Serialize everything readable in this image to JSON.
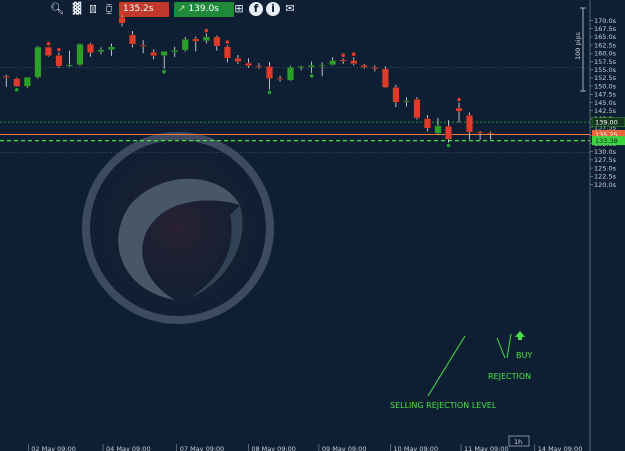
{
  "toolbar": {
    "sell_price": "135.2s",
    "buy_price": "139.0s",
    "icons": [
      "search-icon",
      "bar-chart-icon",
      "chart-type-icon",
      "candle-icon",
      "grid-icon",
      "facebook-icon",
      "info-icon",
      "share-icon"
    ]
  },
  "colors": {
    "background": "#0f1f33",
    "bull": "#2aa02a",
    "bear": "#e03a2a",
    "neutral": "#f0ead0",
    "green_line": "#2aa02a",
    "orange_line": "#f07a3a",
    "annotation": "#46e046"
  },
  "price_axis": {
    "ticks": [
      "170.0s",
      "167.5s",
      "165.0s",
      "162.5s",
      "160.0s",
      "157.5s",
      "155.0s",
      "152.5s",
      "150.0s",
      "147.5s",
      "145.0s",
      "142.5s",
      "140.0s",
      "137.5s",
      "135.0s",
      "132.5s",
      "130.0s",
      "127.5s",
      "125.0s",
      "122.5s",
      "120.0s"
    ],
    "range_label": "100 pips",
    "label_buy": "139.00",
    "label_sell": "135.25",
    "label_level": "133.38"
  },
  "time_axis": {
    "ticks": [
      "02 May 09:00",
      "04 May 09:00",
      "07 May 09:00",
      "08 May 09:00",
      "09 May 09:00",
      "10 May 09:00",
      "11 May 09:00",
      "14 May 09:00"
    ],
    "timeframe": "1h"
  },
  "annotations": {
    "buy": "BUY",
    "rejection": "REJECTION",
    "selling_level": "SELLING REJECTION LEVEL"
  },
  "chart_data": {
    "type": "candlestick",
    "ylim": [
      119.5,
      172
    ],
    "levels": {
      "buy": 139.0,
      "sell": 135.25,
      "rejection_level": 133.38,
      "support_grey": 155.7,
      "lower_grey": 129.8
    },
    "candles": [
      {
        "o": 153.0,
        "h": 153.5,
        "l": 149.8,
        "c": 152.6
      },
      {
        "o": 152.3,
        "h": 152.6,
        "l": 149.8,
        "c": 149.9
      },
      {
        "o": 149.9,
        "h": 152.8,
        "l": 149.5,
        "c": 152.7
      },
      {
        "o": 152.7,
        "h": 162.2,
        "l": 152.3,
        "c": 161.9
      },
      {
        "o": 161.9,
        "h": 162.0,
        "l": 159.0,
        "c": 159.3
      },
      {
        "o": 159.4,
        "h": 160.2,
        "l": 155.6,
        "c": 156.1
      },
      {
        "o": 156.1,
        "h": 160.8,
        "l": 155.8,
        "c": 156.5
      },
      {
        "o": 156.5,
        "h": 163.0,
        "l": 156.2,
        "c": 162.8
      },
      {
        "o": 162.8,
        "h": 163.2,
        "l": 159.0,
        "c": 160.2
      },
      {
        "o": 160.5,
        "h": 161.8,
        "l": 159.7,
        "c": 161.1
      },
      {
        "o": 161.1,
        "h": 163.0,
        "l": 159.2,
        "c": 162.0
      },
      {
        "o": 171.0,
        "h": 171.5,
        "l": 168.2,
        "c": 169.2
      },
      {
        "o": 165.6,
        "h": 166.8,
        "l": 161.8,
        "c": 162.8
      },
      {
        "o": 162.5,
        "h": 164.0,
        "l": 160.0,
        "c": 162.2
      },
      {
        "o": 160.3,
        "h": 161.2,
        "l": 158.2,
        "c": 159.3
      },
      {
        "o": 159.3,
        "h": 160.6,
        "l": 155.3,
        "c": 160.6
      },
      {
        "o": 160.4,
        "h": 162.0,
        "l": 158.9,
        "c": 160.9
      },
      {
        "o": 161.0,
        "h": 165.0,
        "l": 160.5,
        "c": 164.3
      },
      {
        "o": 164.4,
        "h": 165.1,
        "l": 160.6,
        "c": 163.7
      },
      {
        "o": 163.8,
        "h": 166.0,
        "l": 163.0,
        "c": 165.0
      },
      {
        "o": 165.0,
        "h": 165.5,
        "l": 160.8,
        "c": 162.2
      },
      {
        "o": 162.0,
        "h": 162.5,
        "l": 157.2,
        "c": 158.5
      },
      {
        "o": 158.5,
        "h": 159.5,
        "l": 156.8,
        "c": 157.5
      },
      {
        "o": 157.0,
        "h": 158.5,
        "l": 155.6,
        "c": 156.2
      },
      {
        "o": 156.1,
        "h": 157.0,
        "l": 155.3,
        "c": 155.8
      },
      {
        "o": 156.0,
        "h": 157.4,
        "l": 149.0,
        "c": 152.3
      },
      {
        "o": 152.4,
        "h": 153.2,
        "l": 151.4,
        "c": 152.1
      },
      {
        "o": 151.8,
        "h": 156.2,
        "l": 151.6,
        "c": 155.7
      },
      {
        "o": 155.8,
        "h": 156.2,
        "l": 154.8,
        "c": 156.0
      },
      {
        "o": 155.8,
        "h": 157.5,
        "l": 154.0,
        "c": 156.3
      },
      {
        "o": 156.1,
        "h": 157.2,
        "l": 153.0,
        "c": 156.4
      },
      {
        "o": 156.5,
        "h": 158.8,
        "l": 156.3,
        "c": 157.8
      },
      {
        "o": 158.0,
        "h": 158.5,
        "l": 156.8,
        "c": 157.6
      },
      {
        "o": 157.8,
        "h": 158.8,
        "l": 156.3,
        "c": 156.8
      },
      {
        "o": 156.3,
        "h": 156.8,
        "l": 155.3,
        "c": 155.7
      },
      {
        "o": 155.7,
        "h": 156.3,
        "l": 154.5,
        "c": 155.3
      },
      {
        "o": 155.3,
        "h": 156.0,
        "l": 149.4,
        "c": 149.6
      },
      {
        "o": 149.6,
        "h": 150.4,
        "l": 143.6,
        "c": 145.1
      },
      {
        "o": 145.4,
        "h": 146.6,
        "l": 143.8,
        "c": 145.6
      },
      {
        "o": 146.0,
        "h": 146.6,
        "l": 139.8,
        "c": 140.3
      },
      {
        "o": 140.1,
        "h": 141.2,
        "l": 136.2,
        "c": 137.2
      },
      {
        "o": 135.6,
        "h": 140.3,
        "l": 135.2,
        "c": 137.9
      },
      {
        "o": 137.8,
        "h": 139.6,
        "l": 132.8,
        "c": 133.8
      },
      {
        "o": 143.3,
        "h": 145.0,
        "l": 138.9,
        "c": 142.3
      },
      {
        "o": 141.1,
        "h": 142.0,
        "l": 133.7,
        "c": 136.0
      },
      {
        "o": 136.0,
        "h": 136.3,
        "l": 133.6,
        "c": 135.8
      },
      {
        "o": 135.8,
        "h": 136.2,
        "l": 133.8,
        "c": 135.6
      }
    ],
    "markers": [
      {
        "i": 1,
        "type": "low"
      },
      {
        "i": 4,
        "type": "high"
      },
      {
        "i": 5,
        "type": "high"
      },
      {
        "i": 11,
        "type": "high"
      },
      {
        "i": 15,
        "type": "low"
      },
      {
        "i": 19,
        "type": "high"
      },
      {
        "i": 21,
        "type": "high"
      },
      {
        "i": 25,
        "type": "low"
      },
      {
        "i": 29,
        "type": "low"
      },
      {
        "i": 32,
        "type": "high"
      },
      {
        "i": 33,
        "type": "high"
      },
      {
        "i": 42,
        "type": "low"
      },
      {
        "i": 43,
        "type": "high"
      }
    ]
  }
}
